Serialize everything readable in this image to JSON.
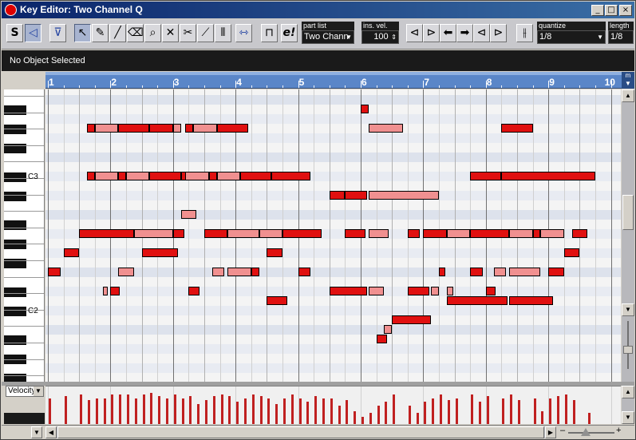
{
  "window": {
    "title": "Key Editor: Two Channel Q"
  },
  "toolbar": {
    "solo_label": "S",
    "part_list": {
      "label": "part list",
      "value": "Two Chann"
    },
    "ins_vel": {
      "label": "ins. vel.",
      "value": "100"
    },
    "quantize": {
      "label": "quantize",
      "value": "1/8"
    },
    "length": {
      "label": "length",
      "value": "1/8"
    },
    "tool_icons": [
      "speaker-icon",
      "arrow-tool-icon",
      "pencil-icon",
      "line-tool-icon",
      "eraser-icon",
      "zoom-icon",
      "mute-icon",
      "scissors-icon",
      "glue-icon",
      "drumstick-icon"
    ]
  },
  "info": {
    "status": "No Object Selected"
  },
  "ruler": {
    "bars": [
      "1",
      "2",
      "3",
      "4",
      "5",
      "6",
      "7",
      "8",
      "9",
      "10"
    ]
  },
  "keyboard": {
    "labels": [
      {
        "text": "C3",
        "row": 9
      },
      {
        "text": "C2",
        "row": 23
      }
    ]
  },
  "velocity": {
    "selector": "Velocity"
  },
  "colors": {
    "note_dark": "#e01010",
    "note_light": "#f09090",
    "ruler": "#5a86c8",
    "velocity_bar": "#c02020",
    "grid_bg": "#f4f4f4",
    "grid_alt": "#dde2ec"
  },
  "notes": [
    {
      "row": 2,
      "start": 11.0,
      "len": 0.25,
      "shade": "dark"
    },
    {
      "row": 4,
      "start": 2.25,
      "len": 0.25,
      "shade": "dark"
    },
    {
      "row": 4,
      "start": 2.5,
      "len": 0.75,
      "shade": "light"
    },
    {
      "row": 4,
      "start": 3.25,
      "len": 1.0,
      "shade": "dark"
    },
    {
      "row": 4,
      "start": 4.25,
      "len": 0.75,
      "shade": "dark"
    },
    {
      "row": 4,
      "start": 5.0,
      "len": 0.25,
      "shade": "light"
    },
    {
      "row": 4,
      "start": 5.4,
      "len": 0.25,
      "shade": "dark"
    },
    {
      "row": 4,
      "start": 5.65,
      "len": 0.75,
      "shade": "light"
    },
    {
      "row": 4,
      "start": 6.4,
      "len": 1.0,
      "shade": "dark"
    },
    {
      "row": 4,
      "start": 11.25,
      "len": 1.1,
      "shade": "light"
    },
    {
      "row": 4,
      "start": 15.5,
      "len": 1.0,
      "shade": "dark"
    },
    {
      "row": 9,
      "start": 2.25,
      "len": 0.25,
      "shade": "dark"
    },
    {
      "row": 9,
      "start": 2.5,
      "len": 0.75,
      "shade": "light"
    },
    {
      "row": 9,
      "start": 3.25,
      "len": 0.25,
      "shade": "dark"
    },
    {
      "row": 9,
      "start": 3.5,
      "len": 0.75,
      "shade": "light"
    },
    {
      "row": 9,
      "start": 4.25,
      "len": 1.0,
      "shade": "dark"
    },
    {
      "row": 9,
      "start": 5.25,
      "len": 0.25,
      "shade": "dark"
    },
    {
      "row": 9,
      "start": 5.4,
      "len": 0.75,
      "shade": "light"
    },
    {
      "row": 9,
      "start": 6.15,
      "len": 0.25,
      "shade": "dark"
    },
    {
      "row": 9,
      "start": 6.4,
      "len": 0.75,
      "shade": "light"
    },
    {
      "row": 9,
      "start": 7.15,
      "len": 1.0,
      "shade": "dark"
    },
    {
      "row": 9,
      "start": 8.15,
      "len": 1.25,
      "shade": "dark"
    },
    {
      "row": 9,
      "start": 14.5,
      "len": 1.0,
      "shade": "dark"
    },
    {
      "row": 9,
      "start": 15.5,
      "len": 3.0,
      "shade": "dark"
    },
    {
      "row": 11,
      "start": 10.0,
      "len": 0.5,
      "shade": "dark"
    },
    {
      "row": 11,
      "start": 10.5,
      "len": 0.7,
      "shade": "dark"
    },
    {
      "row": 11,
      "start": 11.25,
      "len": 2.25,
      "shade": "light"
    },
    {
      "row": 13,
      "start": 5.25,
      "len": 0.5,
      "shade": "light"
    },
    {
      "row": 15,
      "start": 2.0,
      "len": 1.75,
      "shade": "dark"
    },
    {
      "row": 15,
      "start": 3.75,
      "len": 1.25,
      "shade": "light"
    },
    {
      "row": 15,
      "start": 5.0,
      "len": 0.35,
      "shade": "dark"
    },
    {
      "row": 15,
      "start": 6.0,
      "len": 0.75,
      "shade": "dark"
    },
    {
      "row": 15,
      "start": 6.75,
      "len": 1.0,
      "shade": "light"
    },
    {
      "row": 15,
      "start": 7.75,
      "len": 0.75,
      "shade": "light"
    },
    {
      "row": 15,
      "start": 8.5,
      "len": 1.25,
      "shade": "dark"
    },
    {
      "row": 15,
      "start": 10.5,
      "len": 0.65,
      "shade": "dark"
    },
    {
      "row": 15,
      "start": 11.25,
      "len": 0.65,
      "shade": "light"
    },
    {
      "row": 15,
      "start": 12.5,
      "len": 0.4,
      "shade": "dark"
    },
    {
      "row": 15,
      "start": 13.0,
      "len": 0.75,
      "shade": "dark"
    },
    {
      "row": 15,
      "start": 13.75,
      "len": 0.75,
      "shade": "light"
    },
    {
      "row": 15,
      "start": 14.5,
      "len": 1.25,
      "shade": "dark"
    },
    {
      "row": 15,
      "start": 15.75,
      "len": 0.75,
      "shade": "light"
    },
    {
      "row": 15,
      "start": 16.5,
      "len": 0.25,
      "shade": "dark"
    },
    {
      "row": 15,
      "start": 16.75,
      "len": 0.75,
      "shade": "light"
    },
    {
      "row": 15,
      "start": 17.75,
      "len": 0.5,
      "shade": "dark"
    },
    {
      "row": 17,
      "start": 1.5,
      "len": 0.5,
      "shade": "dark"
    },
    {
      "row": 17,
      "start": 4.0,
      "len": 1.15,
      "shade": "dark"
    },
    {
      "row": 17,
      "start": 8.0,
      "len": 0.5,
      "shade": "dark"
    },
    {
      "row": 17,
      "start": 17.5,
      "len": 0.5,
      "shade": "dark"
    },
    {
      "row": 19,
      "start": 1.0,
      "len": 0.4,
      "shade": "dark"
    },
    {
      "row": 19,
      "start": 3.25,
      "len": 0.5,
      "shade": "light"
    },
    {
      "row": 19,
      "start": 6.25,
      "len": 0.4,
      "shade": "light"
    },
    {
      "row": 19,
      "start": 6.75,
      "len": 0.75,
      "shade": "light"
    },
    {
      "row": 19,
      "start": 7.5,
      "len": 0.25,
      "shade": "dark"
    },
    {
      "row": 19,
      "start": 9.0,
      "len": 0.4,
      "shade": "dark"
    },
    {
      "row": 19,
      "start": 13.5,
      "len": 0.2,
      "shade": "dark"
    },
    {
      "row": 19,
      "start": 14.5,
      "len": 0.4,
      "shade": "dark"
    },
    {
      "row": 19,
      "start": 15.25,
      "len": 0.4,
      "shade": "light"
    },
    {
      "row": 19,
      "start": 15.75,
      "len": 1.0,
      "shade": "light"
    },
    {
      "row": 19,
      "start": 17.0,
      "len": 0.5,
      "shade": "dark"
    },
    {
      "row": 21,
      "start": 2.75,
      "len": 0.15,
      "shade": "light"
    },
    {
      "row": 21,
      "start": 3.0,
      "len": 0.3,
      "shade": "dark"
    },
    {
      "row": 21,
      "start": 5.5,
      "len": 0.35,
      "shade": "dark"
    },
    {
      "row": 21,
      "start": 10.0,
      "len": 1.2,
      "shade": "dark"
    },
    {
      "row": 21,
      "start": 11.25,
      "len": 0.5,
      "shade": "light"
    },
    {
      "row": 21,
      "start": 12.5,
      "len": 0.7,
      "shade": "dark"
    },
    {
      "row": 21,
      "start": 13.25,
      "len": 0.25,
      "shade": "light"
    },
    {
      "row": 21,
      "start": 13.75,
      "len": 0.2,
      "shade": "light"
    },
    {
      "row": 21,
      "start": 15.0,
      "len": 0.3,
      "shade": "dark"
    },
    {
      "row": 22,
      "start": 8.0,
      "len": 0.65,
      "shade": "dark"
    },
    {
      "row": 22,
      "start": 13.75,
      "len": 1.95,
      "shade": "dark"
    },
    {
      "row": 22,
      "start": 15.75,
      "len": 1.4,
      "shade": "dark"
    },
    {
      "row": 24,
      "start": 12.0,
      "len": 1.25,
      "shade": "dark"
    },
    {
      "row": 25,
      "start": 11.75,
      "len": 0.25,
      "shade": "light"
    },
    {
      "row": 26,
      "start": 11.5,
      "len": 0.35,
      "shade": "dark"
    }
  ],
  "velocities": [
    {
      "pos": 1.0,
      "h": 0.7
    },
    {
      "pos": 1.5,
      "h": 0.75
    },
    {
      "pos": 2.0,
      "h": 0.8
    },
    {
      "pos": 2.25,
      "h": 0.65
    },
    {
      "pos": 2.5,
      "h": 0.7
    },
    {
      "pos": 2.75,
      "h": 0.7
    },
    {
      "pos": 3.0,
      "h": 0.8
    },
    {
      "pos": 3.25,
      "h": 0.8
    },
    {
      "pos": 3.5,
      "h": 0.8
    },
    {
      "pos": 3.75,
      "h": 0.7
    },
    {
      "pos": 4.0,
      "h": 0.8
    },
    {
      "pos": 4.25,
      "h": 0.85
    },
    {
      "pos": 4.5,
      "h": 0.75
    },
    {
      "pos": 4.75,
      "h": 0.7
    },
    {
      "pos": 5.0,
      "h": 0.8
    },
    {
      "pos": 5.25,
      "h": 0.7
    },
    {
      "pos": 5.5,
      "h": 0.75
    },
    {
      "pos": 5.75,
      "h": 0.55
    },
    {
      "pos": 6.0,
      "h": 0.65
    },
    {
      "pos": 6.25,
      "h": 0.75
    },
    {
      "pos": 6.5,
      "h": 0.8
    },
    {
      "pos": 6.75,
      "h": 0.75
    },
    {
      "pos": 7.0,
      "h": 0.6
    },
    {
      "pos": 7.25,
      "h": 0.7
    },
    {
      "pos": 7.5,
      "h": 0.8
    },
    {
      "pos": 7.75,
      "h": 0.75
    },
    {
      "pos": 8.0,
      "h": 0.7
    },
    {
      "pos": 8.25,
      "h": 0.55
    },
    {
      "pos": 8.5,
      "h": 0.7
    },
    {
      "pos": 8.75,
      "h": 0.8
    },
    {
      "pos": 9.0,
      "h": 0.7
    },
    {
      "pos": 9.25,
      "h": 0.6
    },
    {
      "pos": 9.5,
      "h": 0.75
    },
    {
      "pos": 9.75,
      "h": 0.7
    },
    {
      "pos": 10.0,
      "h": 0.7
    },
    {
      "pos": 10.25,
      "h": 0.5
    },
    {
      "pos": 10.5,
      "h": 0.65
    },
    {
      "pos": 10.75,
      "h": 0.35
    },
    {
      "pos": 11.0,
      "h": 0.2
    },
    {
      "pos": 11.25,
      "h": 0.3
    },
    {
      "pos": 11.5,
      "h": 0.5
    },
    {
      "pos": 11.75,
      "h": 0.6
    },
    {
      "pos": 12.0,
      "h": 0.8
    },
    {
      "pos": 12.5,
      "h": 0.5
    },
    {
      "pos": 12.75,
      "h": 0.3
    },
    {
      "pos": 13.0,
      "h": 0.6
    },
    {
      "pos": 13.25,
      "h": 0.7
    },
    {
      "pos": 13.5,
      "h": 0.8
    },
    {
      "pos": 13.75,
      "h": 0.65
    },
    {
      "pos": 14.0,
      "h": 0.7
    },
    {
      "pos": 14.5,
      "h": 0.8
    },
    {
      "pos": 14.75,
      "h": 0.6
    },
    {
      "pos": 15.0,
      "h": 0.75
    },
    {
      "pos": 15.5,
      "h": 0.7
    },
    {
      "pos": 15.75,
      "h": 0.8
    },
    {
      "pos": 16.0,
      "h": 0.65
    },
    {
      "pos": 16.5,
      "h": 0.7
    },
    {
      "pos": 16.75,
      "h": 0.35
    },
    {
      "pos": 17.0,
      "h": 0.7
    },
    {
      "pos": 17.25,
      "h": 0.75
    },
    {
      "pos": 17.5,
      "h": 0.8
    },
    {
      "pos": 17.75,
      "h": 0.65
    },
    {
      "pos": 18.25,
      "h": 0.3
    }
  ]
}
